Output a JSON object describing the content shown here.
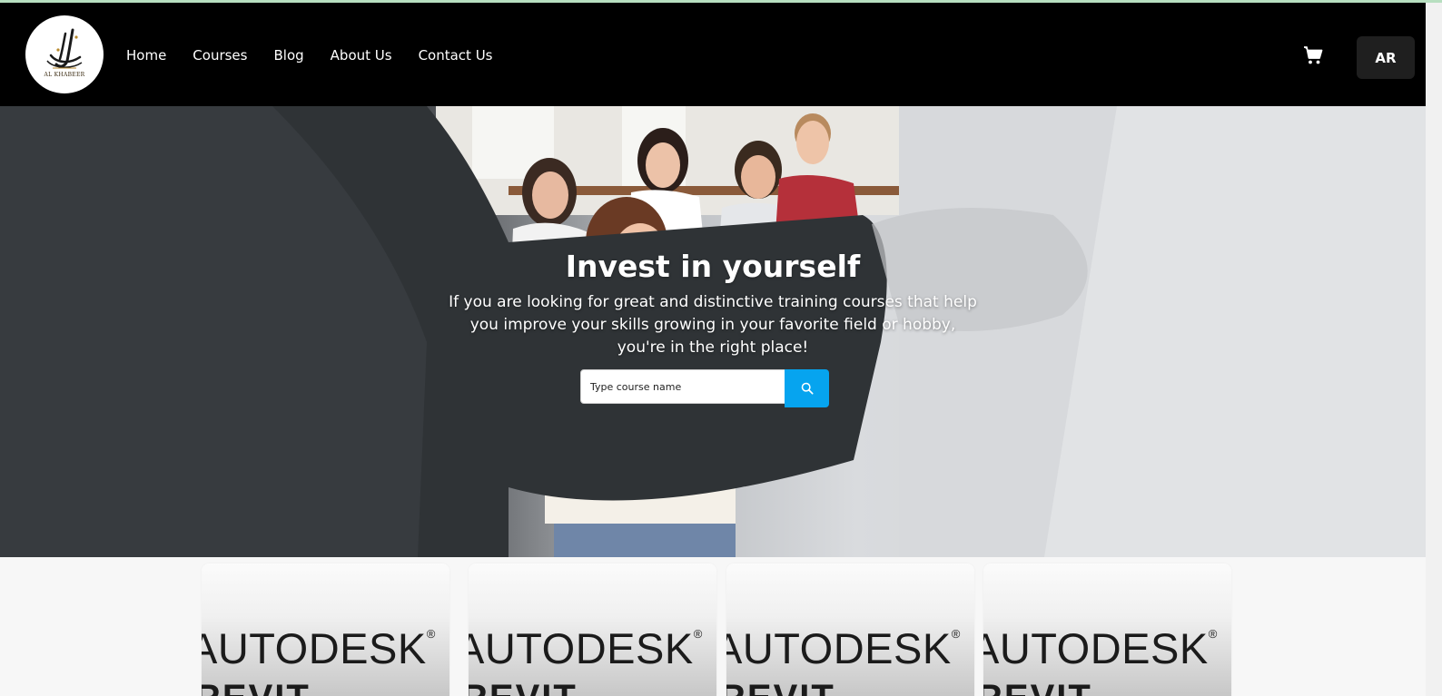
{
  "nav": {
    "logo_text": "AL KHABEER",
    "links": [
      "Home",
      "Courses",
      "Blog",
      "About Us",
      "Contact Us"
    ],
    "cart_icon": "cart-icon",
    "lang_label": "AR"
  },
  "hero": {
    "title": "Invest in yourself",
    "subtitle": "If you are looking for great and distinctive training courses that help you improve your skills growing in your favorite field or hobby, you're in the right place!",
    "search_placeholder": "Type course name",
    "search_icon": "search-icon"
  },
  "cards": [
    {
      "brand": "AUTODESK",
      "mark": "®",
      "sub": "REVIT"
    },
    {
      "brand": "AUTODESK",
      "mark": "®",
      "sub": "REVIT"
    },
    {
      "brand": "AUTODESK",
      "mark": "®",
      "sub": "REVIT"
    },
    {
      "brand": "AUTODESK",
      "mark": "®",
      "sub": "REVIT"
    }
  ],
  "colors": {
    "navbar": "#000000",
    "accent": "#06a4ef",
    "lang_button": "#1f1f1f"
  }
}
